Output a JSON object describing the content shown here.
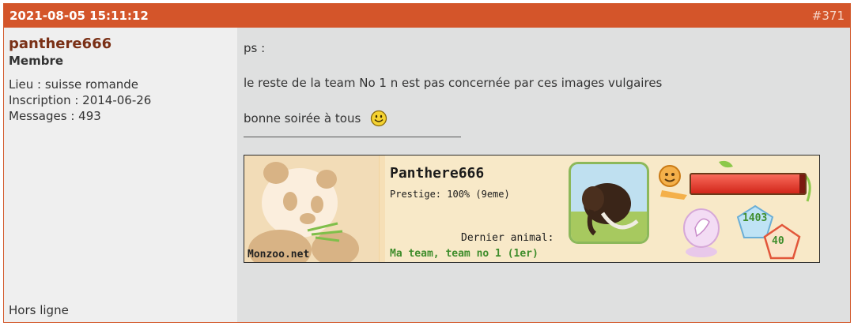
{
  "post": {
    "date": "2021-08-05 15:11:12",
    "number": "#371",
    "header_color": "#d4552a"
  },
  "author": {
    "name": "panthere666",
    "title": "Membre",
    "location": "Lieu : suisse romande",
    "registration": "Inscription : 2014-06-26",
    "messages": "Messages : 493",
    "status": "Hors ligne"
  },
  "message": {
    "lines": [
      "ps :",
      "le reste de la team No 1 n est pas concernée par ces images vulgaires",
      "bonne soirée à tous"
    ],
    "smiley_icon": "smile-icon"
  },
  "signature": {
    "player_name": "Panthere666",
    "prestige": "Prestige: 100% (9eme)",
    "last_animal_label": "Dernier animal:",
    "team_text": "Ma team, team no 1 (1er)",
    "brand": "Monzoo.net",
    "health_level": 0.95,
    "score_blue": "1403",
    "score_red": "40",
    "animal_icon": "mammoth-icon",
    "mascot_icon": "panda-icon"
  }
}
